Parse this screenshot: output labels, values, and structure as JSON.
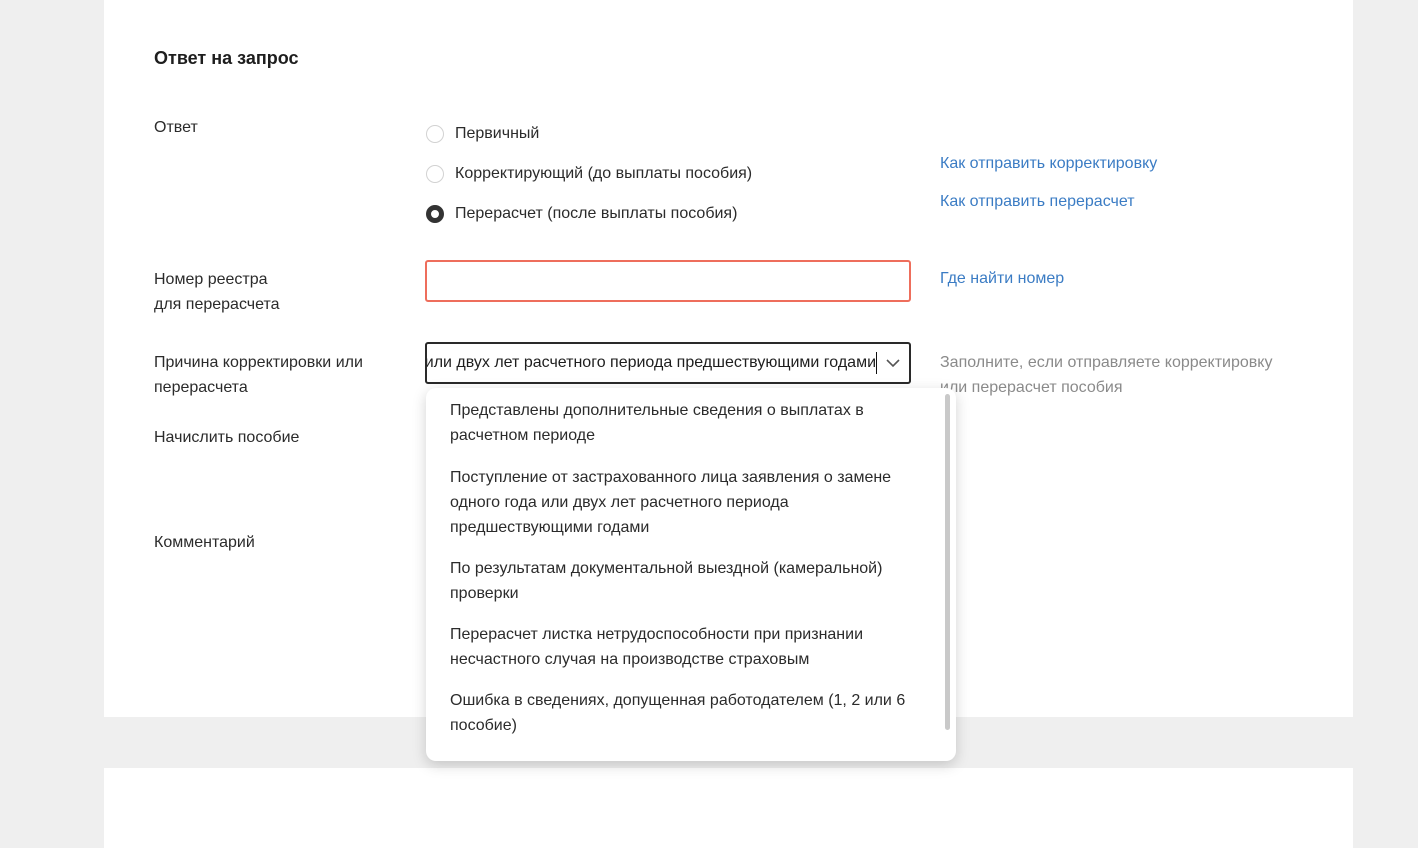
{
  "section": {
    "title": "Ответ на запрос"
  },
  "labels": {
    "answer": "Ответ",
    "registry_line1": "Номер реестра",
    "registry_line2": "для перерасчета",
    "reason_line1": "Причина корректировки или",
    "reason_line2": "перерасчета",
    "accrue": "Начислить пособие",
    "comment": "Комментарий"
  },
  "radios": [
    {
      "label": "Первичный",
      "checked": false
    },
    {
      "label": "Корректирующий (до выплаты пособия)",
      "checked": false
    },
    {
      "label": "Перерасчет (после выплаты пособия)",
      "checked": true
    }
  ],
  "links": {
    "how_correction": "Как отправить корректировку",
    "how_recalc": "Как отправить перерасчет",
    "where_number": "Где найти номер"
  },
  "registry_input": {
    "value": "",
    "placeholder": ""
  },
  "reason_select": {
    "value": "Поступление от застрахованного лица заявления о замене одного года или двух лет расчетного периода предшествующими годами"
  },
  "hint": {
    "line1": "Заполните, если отправляете корректировку",
    "line2": "или перерасчет пособия"
  },
  "dropdown": {
    "options": [
      {
        "line1": "Представлены дополнительные сведения о выплатах в",
        "line2": "расчетном периоде"
      },
      {
        "line1": "Поступление от застрахованного лица заявления о замене",
        "line2": "одного года или двух лет расчетного периода",
        "line3": "предшествующими годами"
      },
      {
        "line1": "По результатам документальной выездной (камеральной)",
        "line2": "проверки"
      },
      {
        "line1": "Перерасчет листка нетрудоспособности при признании",
        "line2": "несчастного случая на производстве страховым"
      },
      {
        "line1": "Ошибка в сведениях, допущенная работодателем (1, 2 или 6",
        "line2": "пособие)"
      }
    ]
  },
  "colors": {
    "link": "#3b7cc4",
    "error_border": "#ee6e5c",
    "hint": "#8a8a8a",
    "page_bg": "#efefef"
  },
  "icons": {
    "select_chevron": "chevron-down-icon"
  }
}
